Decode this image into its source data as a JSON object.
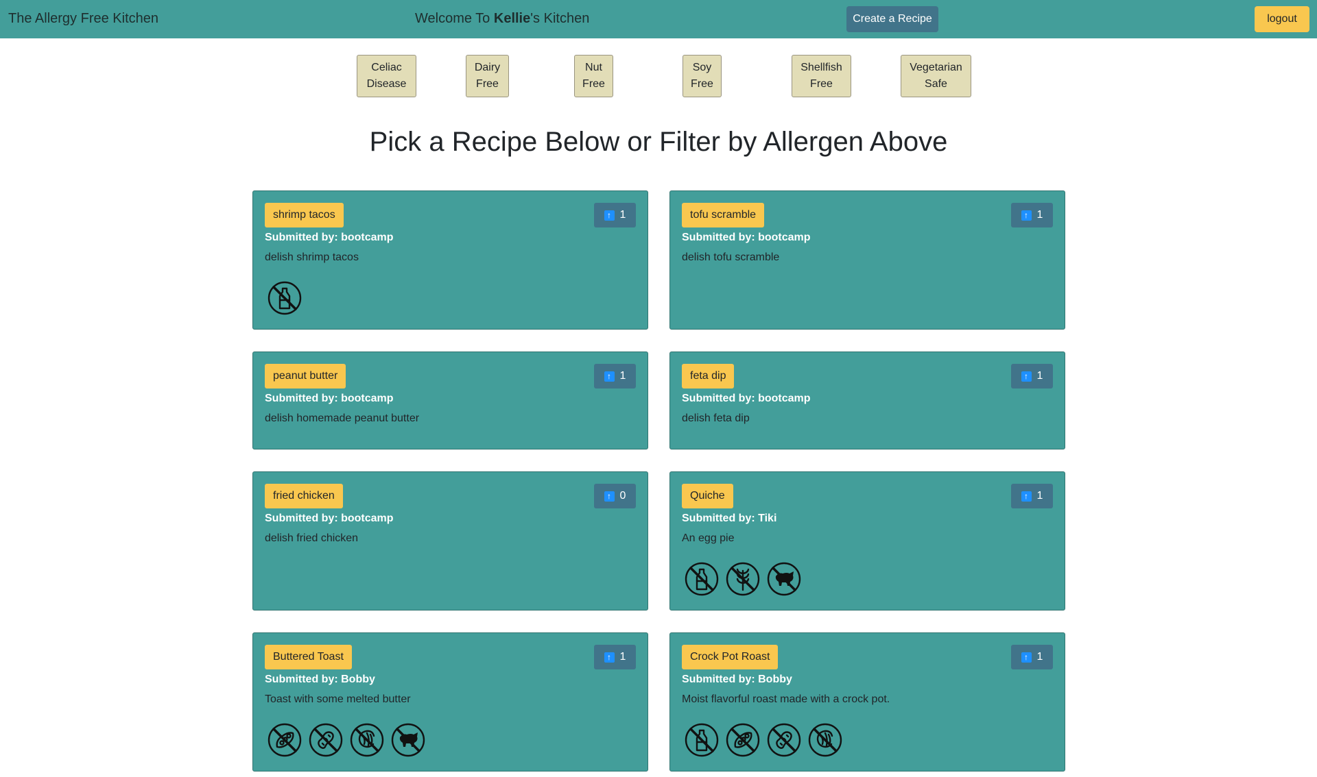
{
  "header": {
    "brand": "The Allergy Free Kitchen",
    "welcome_prefix": "Welcome To ",
    "welcome_name": "Kellie",
    "welcome_suffix": "'s Kitchen",
    "create_label": "Create a Recipe",
    "logout_label": "logout"
  },
  "filters": [
    {
      "line1": "Celiac",
      "line2": "Disease"
    },
    {
      "line1": "Dairy",
      "line2": "Free"
    },
    {
      "line1": "Nut",
      "line2": "Free"
    },
    {
      "line1": "Soy",
      "line2": "Free"
    },
    {
      "line1": "Shellfish",
      "line2": "Free"
    },
    {
      "line1": "Vegetarian",
      "line2": "Safe"
    }
  ],
  "heading": "Pick a Recipe Below or Filter by Allergen Above",
  "recipes": [
    {
      "title": "shrimp tacos",
      "votes": "1",
      "submitted": "Submitted by: bootcamp",
      "description": "delish shrimp tacos",
      "icons": [
        "no-dairy-icon"
      ]
    },
    {
      "title": "tofu scramble",
      "votes": "1",
      "submitted": "Submitted by: bootcamp",
      "description": "delish tofu scramble",
      "icons": []
    },
    {
      "title": "peanut butter",
      "votes": "1",
      "submitted": "Submitted by: bootcamp",
      "description": "delish homemade peanut butter",
      "icons": []
    },
    {
      "title": "feta dip",
      "votes": "1",
      "submitted": "Submitted by: bootcamp",
      "description": "delish feta dip",
      "icons": []
    },
    {
      "title": "fried chicken",
      "votes": "0",
      "submitted": "Submitted by: bootcamp",
      "description": "delish fried chicken",
      "icons": []
    },
    {
      "title": "Quiche",
      "votes": "1",
      "submitted": "Submitted by: Tiki",
      "description": "An egg pie",
      "icons": [
        "no-dairy-icon",
        "no-gluten-icon",
        "no-meat-icon"
      ]
    },
    {
      "title": "Buttered Toast",
      "votes": "1",
      "submitted": "Submitted by: Bobby",
      "description": "Toast with some melted butter",
      "icons": [
        "no-soy-icon",
        "no-peanut-icon",
        "no-shellfish-icon",
        "no-meat-icon"
      ]
    },
    {
      "title": "Crock Pot Roast",
      "votes": "1",
      "submitted": "Submitted by: Bobby",
      "description": "Moist flavorful roast made with a crock pot.",
      "icons": [
        "no-dairy-icon",
        "no-soy-icon",
        "no-peanut-icon",
        "no-shellfish-icon"
      ]
    }
  ]
}
